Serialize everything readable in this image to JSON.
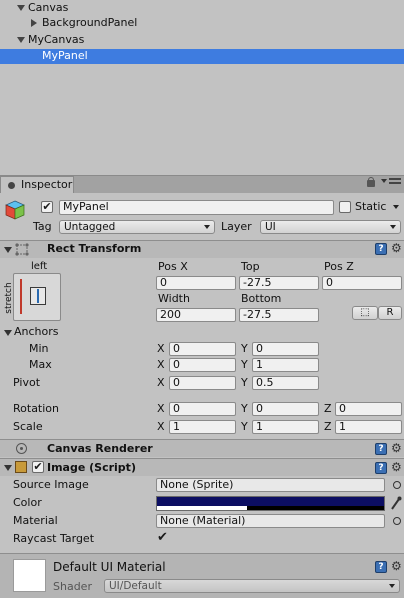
{
  "hierarchy": {
    "items": [
      {
        "label": "Canvas"
      },
      {
        "label": "BackgroundPanel"
      },
      {
        "label": "MyCanvas"
      },
      {
        "label": "MyPanel"
      }
    ]
  },
  "tab": {
    "label": "Inspector"
  },
  "object": {
    "name": "MyPanel",
    "static_label": "Static",
    "tag_label": "Tag",
    "tag_value": "Untagged",
    "layer_label": "Layer",
    "layer_value": "UI",
    "enabled": true
  },
  "rect_transform": {
    "title": "Rect Transform",
    "anchor_h_label": "left",
    "anchor_v_label": "stretch",
    "col1_label": "Pos X",
    "col2_label": "Top",
    "col3_label": "Pos Z",
    "pos_x": "0",
    "top": "-27.5",
    "pos_z": "0",
    "width_label": "Width",
    "bottom_label": "Bottom",
    "width": "200",
    "bottom": "-27.5",
    "r_button": "R",
    "anchors_label": "Anchors",
    "min_label": "Min",
    "max_label": "Max",
    "min_x": "0",
    "min_y": "0",
    "max_x": "0",
    "max_y": "1",
    "pivot_label": "Pivot",
    "pivot_x": "0",
    "pivot_y": "0.5",
    "rotation_label": "Rotation",
    "rot_x": "0",
    "rot_y": "0",
    "rot_z": "0",
    "scale_label": "Scale",
    "scale_x": "1",
    "scale_y": "1",
    "scale_z": "1",
    "x": "X",
    "y": "Y",
    "z": "Z"
  },
  "canvas_renderer": {
    "title": "Canvas Renderer"
  },
  "image_script": {
    "title": "Image (Script)",
    "source_image_label": "Source Image",
    "source_image_value": "None (Sprite)",
    "color_label": "Color",
    "color_value": "#0c0e63",
    "material_label": "Material",
    "material_value": "None (Material)",
    "raycast_label": "Raycast Target",
    "raycast_checked": true,
    "enabled": true
  },
  "material": {
    "name": "Default UI Material",
    "shader_label": "Shader",
    "shader_value": "UI/Default"
  }
}
